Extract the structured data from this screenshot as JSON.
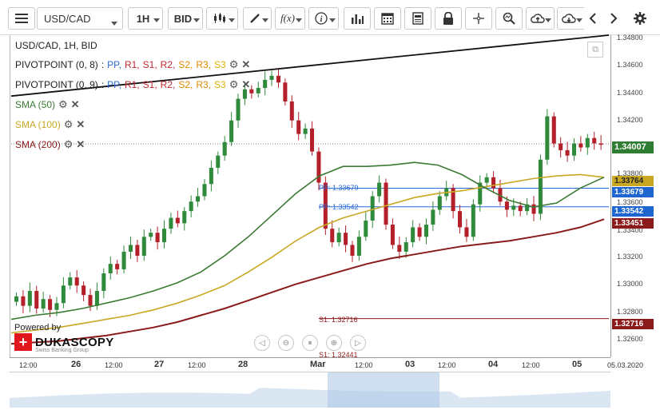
{
  "toolbar": {
    "symbol": "USD/CAD",
    "timeframe": "1H",
    "side": "BID",
    "fx_label": "f(x)",
    "info_label": "i"
  },
  "legend": {
    "title": "USD/CAD, 1H, BID",
    "pivot1_name": "PIVOTPOINT (0, 8)",
    "pivot2_name": "PIVOTPOINT (0, 9)",
    "pivot_sep": ":",
    "pp": "PP,",
    "r1": "R1,",
    "s1": "S1,",
    "r2": "R2,",
    "s2": "S2,",
    "r3": "R3,",
    "s3": "S3",
    "sma50": "SMA (50)",
    "sma100": "SMA (100)",
    "sma200": "SMA (200)",
    "gear": "⚙",
    "close": "✕"
  },
  "price_axis": {
    "ticks": [
      "1.34800",
      "1.34600",
      "1.34400",
      "1.34200",
      "1.33800",
      "1.33600",
      "1.33400",
      "1.33200",
      "1.33000",
      "1.32800",
      "1.32600"
    ],
    "tags": {
      "current": "1.34007",
      "sma100": "1.33764",
      "pp1": "1.33679",
      "pp2": "1.33542",
      "sma200": "1.33451",
      "s1": "1.32716"
    },
    "colors": {
      "current": "#2f7d32",
      "sma100": "#c8a823",
      "pp": "#1e65d0",
      "sma200": "#8b1a1a",
      "s1": "#8b1a1a"
    }
  },
  "levels": {
    "pp1_label": "PP: 1.33679",
    "pp2_label": "PP: 1.33542",
    "s1_label": "S1: 1.32716",
    "s1b_label": "S1: 1.32441"
  },
  "time_axis": {
    "labels": [
      "12:00",
      "26",
      "12:00",
      "27",
      "12:00",
      "28",
      "Mar",
      "12:00",
      "03",
      "12:00",
      "04",
      "12:00",
      "05",
      "05.03.2020"
    ]
  },
  "logo": {
    "powered_by": "Powered by",
    "name": "DUKASCOPY",
    "sub": "Swiss Banking Group",
    "mark": "+"
  },
  "navigation": {
    "prev": "◁",
    "zoom_out": "⊖",
    "pause": "⏸",
    "zoom_in": "⊕",
    "next": "▷"
  },
  "chart_data": {
    "type": "candlestick",
    "title": "USD/CAD, 1H, BID",
    "ylim": [
      1.3243,
      1.3481
    ],
    "current_price": 1.34007,
    "levels": {
      "pp_8": 1.33679,
      "pp_9": 1.33542,
      "s1": 1.32716,
      "sma100": 1.33764,
      "sma200": 1.33451
    },
    "sma50_color": "#3a7a32",
    "sma100_color": "#c8a823",
    "sma200_color": "#8b1a1a",
    "trendline_color": "#111111",
    "up_color": "#2f8a3b",
    "down_color": "#b3202a",
    "close_path": [
      1.3288,
      1.3281,
      1.3292,
      1.3279,
      1.3286,
      1.3278,
      1.3283,
      1.3296,
      1.3302,
      1.3296,
      1.3289,
      1.3281,
      1.3292,
      1.3305,
      1.3312,
      1.3308,
      1.3321,
      1.3326,
      1.3318,
      1.3332,
      1.3335,
      1.3328,
      1.3338,
      1.3346,
      1.3342,
      1.3351,
      1.3358,
      1.3362,
      1.3371,
      1.3383,
      1.3392,
      1.3402,
      1.3418,
      1.3434,
      1.3441,
      1.3438,
      1.3442,
      1.3448,
      1.3451,
      1.3446,
      1.3432,
      1.3418,
      1.3408,
      1.3412,
      1.3395,
      1.3372,
      1.3338,
      1.3328,
      1.3335,
      1.3326,
      1.3318,
      1.3332,
      1.3344,
      1.3362,
      1.3372,
      1.3341,
      1.3326,
      1.3321,
      1.3328,
      1.3339,
      1.3332,
      1.3341,
      1.3352,
      1.3362,
      1.3368,
      1.3351,
      1.3339,
      1.3332,
      1.3356,
      1.3372,
      1.3376,
      1.3368,
      1.3358,
      1.3352,
      1.3355,
      1.3351,
      1.3356,
      1.3349,
      1.3389,
      1.3421,
      1.3401,
      1.3396,
      1.3392,
      1.3401,
      1.3398,
      1.3405,
      1.3401,
      1.34
    ],
    "sma50_path": [
      1.3271,
      1.3274,
      1.3276,
      1.3279,
      1.3283,
      1.3287,
      1.3292,
      1.3298,
      1.3306,
      1.3318,
      1.3332,
      1.3348,
      1.3364,
      1.3377,
      1.3384,
      1.3384,
      1.3385,
      1.3387,
      1.3385,
      1.3378,
      1.3368,
      1.3359,
      1.3354,
      1.3357,
      1.3368,
      1.3376
    ],
    "sma100_path": [
      1.3261,
      1.3263,
      1.3265,
      1.3268,
      1.3271,
      1.3274,
      1.3278,
      1.3283,
      1.3289,
      1.3296,
      1.3306,
      1.3317,
      1.3329,
      1.3339,
      1.3346,
      1.3351,
      1.3356,
      1.3361,
      1.3364,
      1.3366,
      1.3369,
      1.3372,
      1.3375,
      1.3377,
      1.3378,
      1.3376
    ],
    "sma200_path": [
      1.3253,
      1.3254,
      1.3255,
      1.3257,
      1.3259,
      1.3262,
      1.3265,
      1.3269,
      1.3274,
      1.3279,
      1.3285,
      1.3291,
      1.3297,
      1.3302,
      1.3307,
      1.3312,
      1.3316,
      1.3319,
      1.3322,
      1.3325,
      1.3327,
      1.3329,
      1.3332,
      1.3335,
      1.3339,
      1.3345
    ],
    "trendline": {
      "from": 1.3436,
      "to": 1.3481
    },
    "support_line": {
      "from": 1.3258,
      "to": 1.3338
    }
  }
}
